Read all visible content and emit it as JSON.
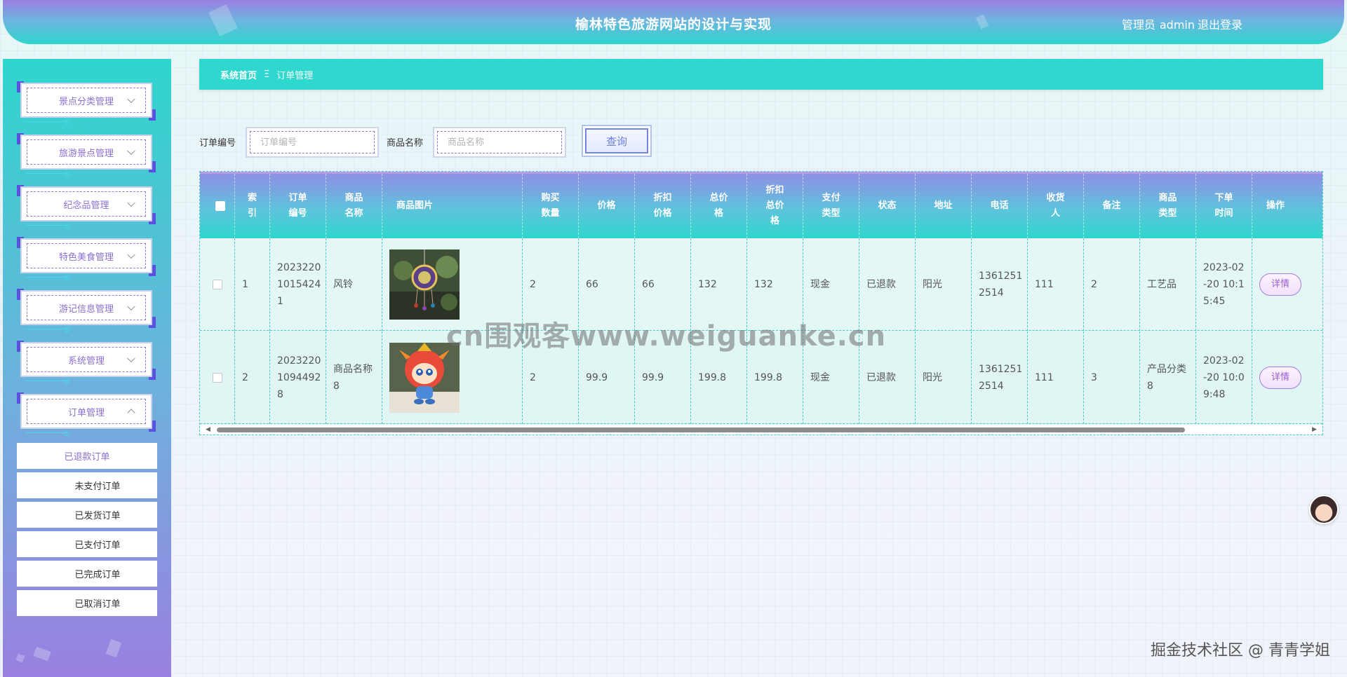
{
  "header": {
    "title": "榆林特色旅游网站的设计与实现",
    "user_role": "管理员",
    "user_name": "admin",
    "logout": "退出登录"
  },
  "sidebar": {
    "menus": [
      {
        "label": "景点分类管理",
        "expanded": false
      },
      {
        "label": "旅游景点管理",
        "expanded": false
      },
      {
        "label": "纪念品管理",
        "expanded": false
      },
      {
        "label": "特色美食管理",
        "expanded": false
      },
      {
        "label": "游记信息管理",
        "expanded": false
      },
      {
        "label": "系统管理",
        "expanded": false
      },
      {
        "label": "订单管理",
        "expanded": true
      }
    ],
    "submenus": [
      {
        "label": "已退款订单",
        "active": true
      },
      {
        "label": "未支付订单",
        "active": false
      },
      {
        "label": "已发货订单",
        "active": false
      },
      {
        "label": "已支付订单",
        "active": false
      },
      {
        "label": "已完成订单",
        "active": false
      },
      {
        "label": "已取消订单",
        "active": false
      }
    ]
  },
  "breadcrumb": {
    "home": "系统首页",
    "separator": "Ξ",
    "current": "订单管理"
  },
  "search": {
    "order_no_label": "订单编号",
    "order_no_placeholder": "订单编号",
    "order_no_value": "",
    "product_name_label": "商品名称",
    "product_name_placeholder": "商品名称",
    "product_name_value": "",
    "query_button": "查询"
  },
  "table": {
    "headers": [
      "索引",
      "订单编号",
      "商品名称",
      "商品图片",
      "购买数量",
      "价格",
      "折扣价格",
      "总价格",
      "折扣总价格",
      "支付类型",
      "状态",
      "地址",
      "电话",
      "收货人",
      "备注",
      "商品类型",
      "下单时间",
      "操作"
    ],
    "header_lines": {
      "index": [
        "索",
        "引"
      ],
      "order_no": [
        "订单",
        "编号"
      ],
      "product_name": [
        "商品",
        "名称"
      ],
      "image": [
        "商品图片"
      ],
      "qty": [
        "购买",
        "数量"
      ],
      "price": [
        "价格"
      ],
      "disc_price": [
        "折扣",
        "价格"
      ],
      "total": [
        "总价",
        "格"
      ],
      "disc_total": [
        "折扣",
        "总价",
        "格"
      ],
      "pay_type": [
        "支付",
        "类型"
      ],
      "status": [
        "状态"
      ],
      "address": [
        "地址"
      ],
      "phone": [
        "电话"
      ],
      "receiver": [
        "收货",
        "人"
      ],
      "remark": [
        "备注"
      ],
      "type": [
        "商品",
        "类型"
      ],
      "time": [
        "下单",
        "时间"
      ],
      "action": [
        "操作"
      ]
    },
    "rows": [
      {
        "index": "1",
        "order_no": [
          "2023220",
          "1015424",
          "1"
        ],
        "product_name": [
          "风铃"
        ],
        "image_icon": "wind-chime-photo",
        "qty": "2",
        "price": "66",
        "disc_price": "66",
        "total": "132",
        "disc_total": "132",
        "pay_type": "现金",
        "status": "已退款",
        "address": "阳光",
        "phone": [
          "1361251",
          "2514"
        ],
        "receiver": "111",
        "remark": "2",
        "type": [
          "工艺品"
        ],
        "time": [
          "2023-02",
          "-20 10:1",
          "5:45"
        ],
        "action": "详情"
      },
      {
        "index": "2",
        "order_no": [
          "2023220",
          "1094492",
          "8"
        ],
        "product_name": [
          "商品名称",
          "8"
        ],
        "image_icon": "mascot-doll-photo",
        "qty": "2",
        "price": "99.9",
        "disc_price": "99.9",
        "total": "199.8",
        "disc_total": "199.8",
        "pay_type": "现金",
        "status": "已退款",
        "address": "阳光",
        "phone": [
          "1361251",
          "2514"
        ],
        "receiver": "111",
        "remark": "3",
        "type": [
          "产品分类",
          "8"
        ],
        "time": [
          "2023-02",
          "-20 10:0",
          "9:48"
        ],
        "action": "详情"
      }
    ]
  },
  "watermark": "cn围观客www.weiguanke.cn",
  "footer_mark": "掘金技术社区 @ 青青学姐",
  "colors": {
    "accent_teal": "#2ed8cf",
    "accent_purple": "#9a7fe0",
    "menu_text": "#8c6fd2"
  }
}
